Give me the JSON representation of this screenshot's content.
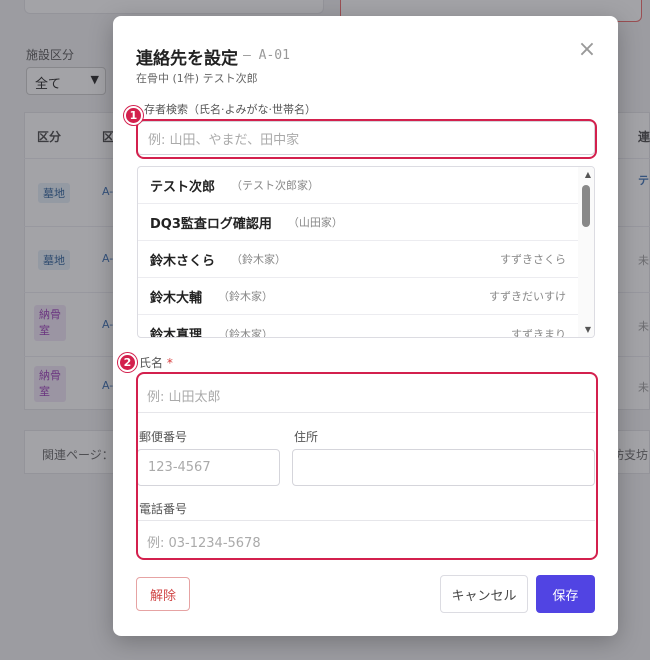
{
  "background": {
    "filter_label": "施設区分",
    "filter_value": "全て",
    "table_headers": [
      "区分",
      "区",
      "連"
    ],
    "rows": [
      {
        "badge": "墓地",
        "badge_color": "blue",
        "code": "A-"
      },
      {
        "badge": "墓地",
        "badge_color": "blue",
        "code": "A-"
      },
      {
        "badge": "納骨\n室",
        "badge_color": "purple",
        "code": "A-"
      },
      {
        "badge": "納骨\n室",
        "badge_color": "purple",
        "code": "A-"
      }
    ],
    "right_cells": [
      "テ",
      "未",
      "未",
      "未"
    ],
    "related_label": "関連ページ：",
    "related_right": "坊支坊"
  },
  "modal": {
    "title": "連絡先を設定",
    "code": "– A-01",
    "subtitle": "在骨中 (1件) テスト次郎",
    "search": {
      "label": "存者検索（氏名·よみがな·世帯名）",
      "placeholder": "例: 山田、やまだ、田中家"
    },
    "results": [
      {
        "name": "テスト次郎",
        "house": "（テスト次郎家）",
        "kana": ""
      },
      {
        "name": "DQ3監査ログ確認用",
        "house": "（山田家）",
        "kana": ""
      },
      {
        "name": "鈴木さくら",
        "house": "（鈴木家）",
        "kana": "すずきさくら"
      },
      {
        "name": "鈴木大輔",
        "house": "（鈴木家）",
        "kana": "すずきだいすけ"
      },
      {
        "name": "鈴木真理",
        "house": "（鈴木家）",
        "kana": "すずきまり"
      }
    ],
    "name_field": {
      "label": "氏名",
      "required_mark": "*",
      "placeholder": "例: 山田太郎"
    },
    "postal_field": {
      "label": "郵便番号",
      "placeholder": "123-4567"
    },
    "address_field": {
      "label": "住所",
      "placeholder": ""
    },
    "phone_field": {
      "label": "電話番号",
      "placeholder": "例: 03-1234-5678"
    },
    "buttons": {
      "release": "解除",
      "cancel": "キャンセル",
      "save": "保存"
    },
    "close_icon": "×"
  },
  "annotations": {
    "marker_1": "1",
    "marker_2": "2",
    "highlight_color": "#d3204d"
  },
  "colors": {
    "accent": "#5144e3",
    "danger": "#d04545"
  }
}
